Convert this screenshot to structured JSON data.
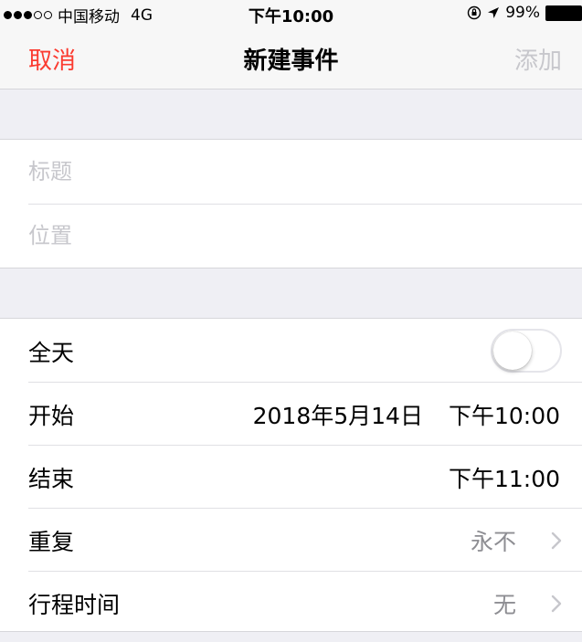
{
  "status_bar": {
    "carrier": "中国移动",
    "network": "4G",
    "time": "下午10:00",
    "battery": "99%"
  },
  "nav": {
    "cancel_label": "取消",
    "title": "新建事件",
    "add_label": "添加"
  },
  "form": {
    "title_placeholder": "标题",
    "location_placeholder": "位置"
  },
  "details": {
    "all_day_label": "全天",
    "all_day_on": false,
    "start_label": "开始",
    "start_date": "2018年5月14日",
    "start_time": "下午10:00",
    "end_label": "结束",
    "end_time": "下午11:00",
    "repeat_label": "重复",
    "repeat_value": "永不",
    "travel_label": "行程时间",
    "travel_value": "无"
  },
  "colors": {
    "accent": "#fb3b30",
    "disabled": "#c7c7cc",
    "muted": "#8e8e93"
  },
  "icons": [
    "rotation-lock-icon",
    "location-arrow-icon",
    "battery-icon",
    "chevron-right-icon"
  ]
}
